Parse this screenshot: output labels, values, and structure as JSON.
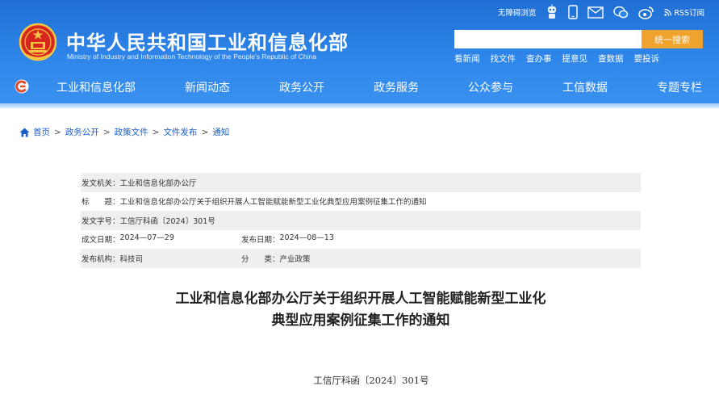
{
  "header": {
    "title": "中华人民共和国工业和信息化部",
    "subtitle": "Ministry of Industry and Information Technology of the People's Republic of China",
    "top_links": {
      "accessibility": "无障碍浏览",
      "rss": "RSS订阅"
    },
    "search": {
      "placeholder": "",
      "button_label": "统一搜索"
    },
    "quick_links": [
      "看新闻",
      "找文件",
      "查办事",
      "提意见",
      "查数据",
      "要投诉"
    ]
  },
  "nav": {
    "items": [
      "工业和信息化部",
      "新闻动态",
      "政务公开",
      "政务服务",
      "公众参与",
      "工信数据",
      "专题专栏"
    ]
  },
  "breadcrumb": {
    "items": [
      "首页",
      "政务公开",
      "政策文件",
      "文件发布",
      "通知"
    ],
    "separator": ">"
  },
  "meta": {
    "issuer_label": "发文机关：",
    "issuer": "工业和信息化部办公厅",
    "title_label": "标　　题：",
    "title": "工业和信息化部办公厅关于组织开展人工智能赋能新型工业化典型应用案例征集工作的通知",
    "doc_no_label": "发文字号：",
    "doc_no": "工信厅科函〔2024〕301号",
    "created_label": "成文日期：",
    "created": "2024—07—29",
    "published_label": "发布日期：",
    "published": "2024—08—13",
    "org_label": "发布机构：",
    "org": "科技司",
    "category_label": "分　　类：",
    "category": "产业政策"
  },
  "article": {
    "title_line1": "工业和信息化部办公厅关于组织开展人工智能赋能新型工业化",
    "title_line2": "典型应用案例征集工作的通知",
    "doc_number": "工信厅科函〔2024〕301号"
  },
  "colors": {
    "header_blue": "#2f86ea",
    "search_button": "#f0a22e",
    "link_blue": "#1a5ec9",
    "meta_row_alt": "#efefef"
  }
}
